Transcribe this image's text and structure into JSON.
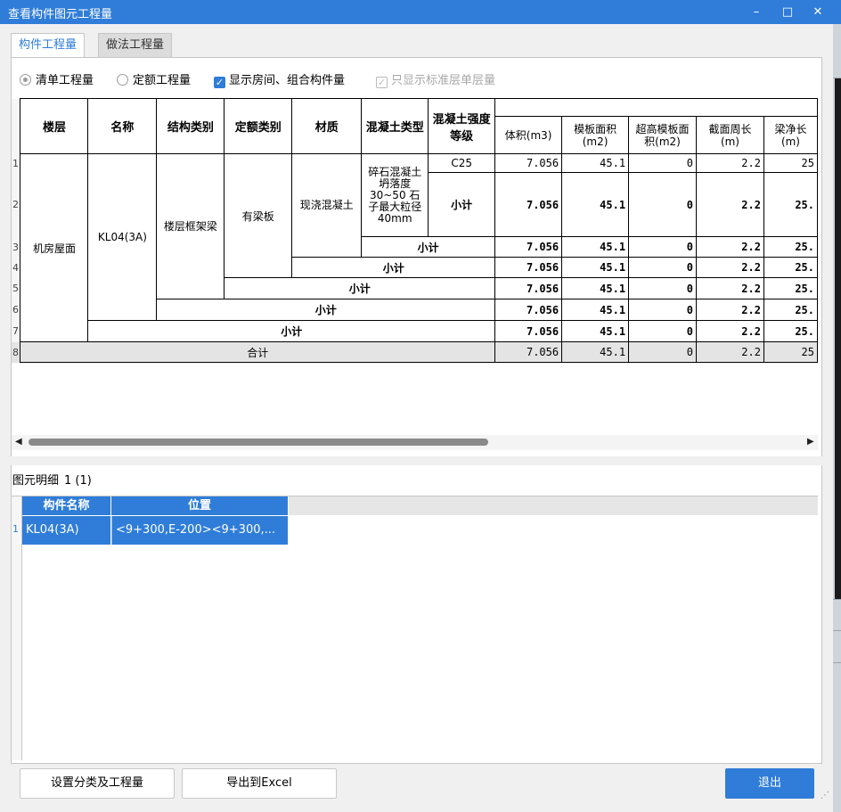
{
  "window": {
    "title": "查看构件图元工程量",
    "minimize": "–",
    "maximize": "□",
    "close": "✕"
  },
  "tabs": [
    {
      "label": "构件工程量"
    },
    {
      "label": "做法工程量"
    }
  ],
  "options": {
    "radio1": "清单工程量",
    "radio2": "定额工程量",
    "check1": "显示房间、组合构件量",
    "check2": "只显示标准层单层量"
  },
  "table": {
    "headers": {
      "floor": "楼层",
      "name": "名称",
      "struct": "结构类别",
      "quota": "定额类别",
      "material": "材质",
      "concrete_type": "混凝土类型",
      "concrete_grade": "混凝土强度等级",
      "volume": "体积(m3)",
      "formwork": "模板面积(m2)",
      "super_formwork": "超高模板面积(m2)",
      "perimeter": "截面周长(m)",
      "length": "梁净长(m)"
    },
    "row_numbers": [
      "1",
      "2",
      "3",
      "4",
      "5",
      "6",
      "7",
      "8"
    ],
    "floor": "机房屋面",
    "name": "KL04(3A)",
    "struct": "楼层框架梁",
    "quota": "有梁板",
    "material": "现浇混凝土",
    "concrete_type": "碎石混凝土 坍落度30~50 石子最大粒径40mm",
    "grade": "C25",
    "subtotal": "小计",
    "total": "合计",
    "values": {
      "volume": "7.056",
      "formwork": "45.1",
      "super": "0",
      "perimeter": "2.2",
      "length": "25.",
      "length_plain": "25"
    }
  },
  "detail": {
    "label": "图元明细",
    "count": "1 (1)",
    "headers": {
      "name": "构件名称",
      "position": "位置"
    },
    "row_number": "1",
    "rows": [
      {
        "name": "KL04(3A)",
        "position": "<9+300,E-200><9+300,..."
      }
    ]
  },
  "buttons": {
    "settings": "设置分类及工程量",
    "export": "导出到Excel",
    "exit": "退出"
  }
}
